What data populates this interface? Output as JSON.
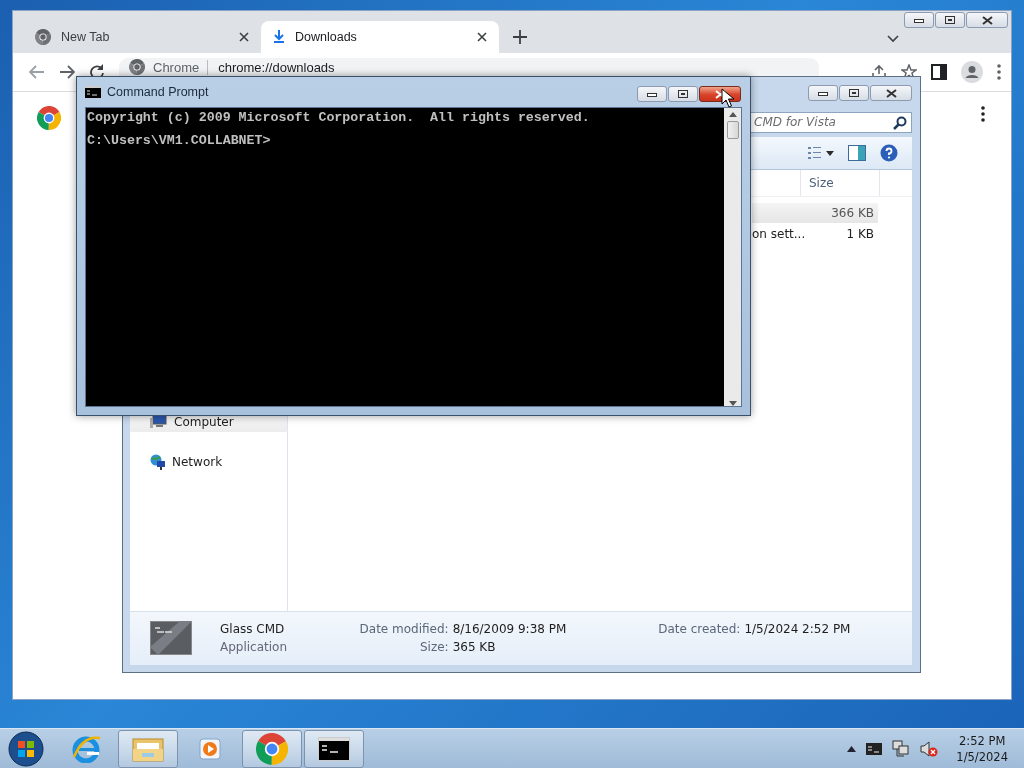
{
  "browser": {
    "tabs": [
      {
        "label": "New Tab",
        "selected": false,
        "kind": "newtab"
      },
      {
        "label": "Downloads",
        "selected": true,
        "kind": "download"
      }
    ],
    "address_bar": {
      "site_chip": "Chrome",
      "url": "chrome://downloads"
    }
  },
  "explorer": {
    "search": {
      "placeholder": "CMD for Vista"
    },
    "columns": [
      {
        "label": "Size"
      }
    ],
    "rows": [
      {
        "selected": true,
        "size": "366 KB"
      },
      {
        "name": "on sett...",
        "selected": false,
        "size": "1 KB"
      }
    ],
    "navigation": [
      {
        "label": "Computer",
        "kind": "computer",
        "selected": true
      },
      {
        "label": "Network",
        "kind": "network",
        "selected": false
      }
    ],
    "details": {
      "name": "Glass CMD",
      "type": "Application",
      "fields": [
        {
          "label": "Date modified:",
          "value": "8/16/2009 9:38 PM"
        },
        {
          "label": "Size:",
          "value": "365 KB"
        },
        {
          "label": "Date created:",
          "value": "1/5/2024 2:52 PM"
        }
      ]
    }
  },
  "command_prompt": {
    "title": "Command Prompt",
    "close_hovered": true,
    "lines": [
      "Copyright (c) 2009 Microsoft Corporation.  All rights reserved.",
      "C:\\Users\\VM1.COLLABNET>"
    ]
  },
  "taskbar": {
    "items": [
      {
        "kind": "ie",
        "active": false
      },
      {
        "kind": "folder",
        "active": true
      },
      {
        "kind": "media",
        "active": false
      },
      {
        "kind": "chrome",
        "active": true
      },
      {
        "kind": "console",
        "active": true
      }
    ],
    "clock": {
      "time": "2:52 PM",
      "date": "1/5/2024"
    }
  }
}
